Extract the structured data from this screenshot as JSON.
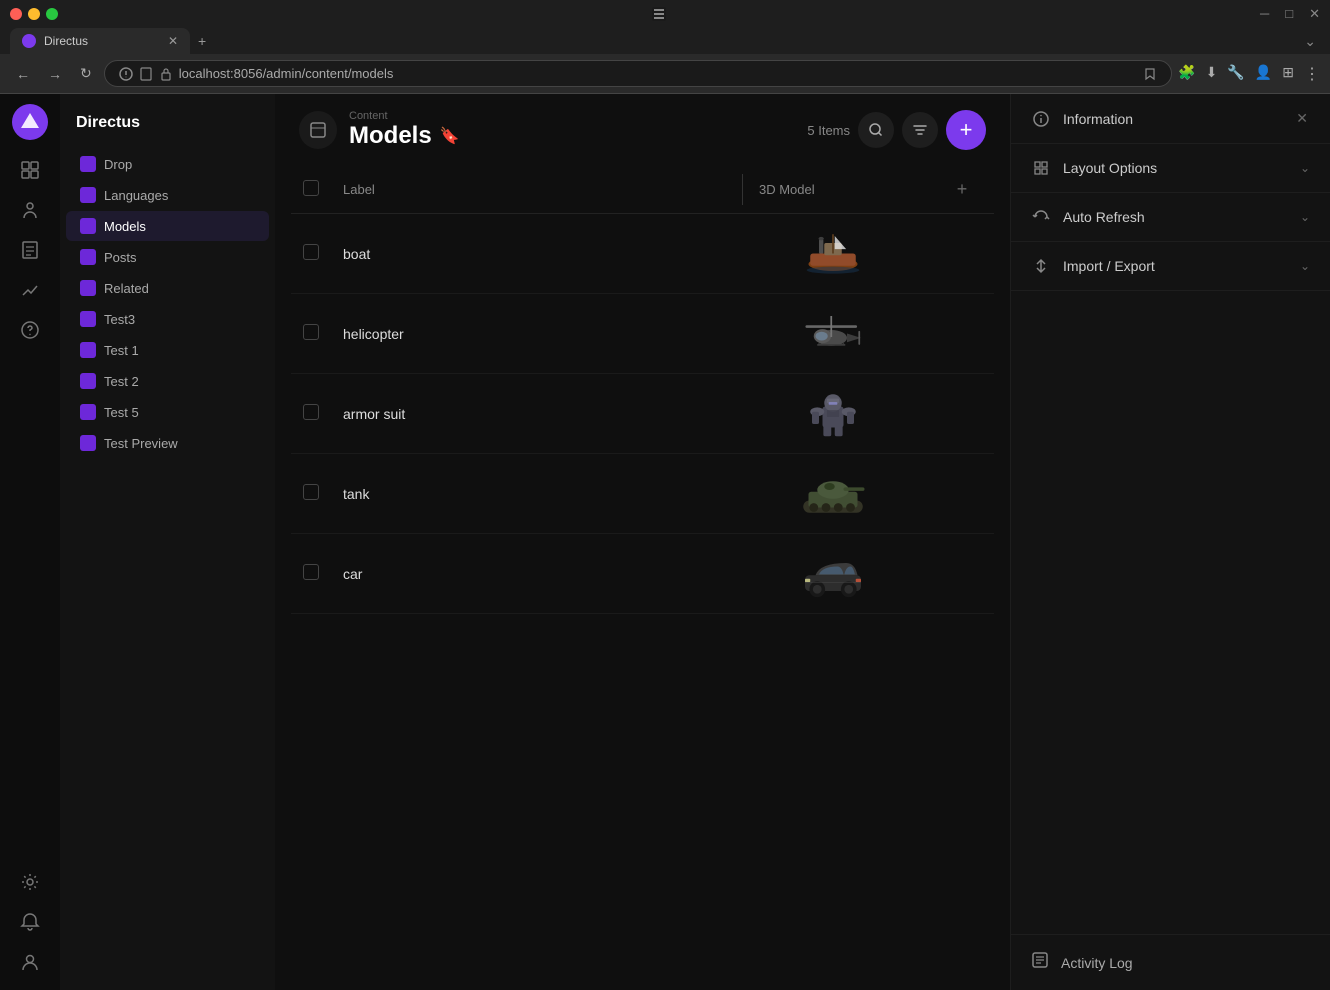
{
  "browser": {
    "tab_title": "Directus",
    "url": "localhost:8056/admin/content/models",
    "nav_back": "←",
    "nav_forward": "→",
    "nav_refresh": "↻"
  },
  "icon_sidebar": {
    "items": [
      {
        "name": "content-icon",
        "symbol": "◧"
      },
      {
        "name": "users-icon",
        "symbol": "👤"
      },
      {
        "name": "files-icon",
        "symbol": "📁"
      },
      {
        "name": "analytics-icon",
        "symbol": "📊"
      },
      {
        "name": "help-icon",
        "symbol": "?"
      },
      {
        "name": "settings-icon",
        "symbol": "⚙"
      }
    ],
    "bell_label": "🔔",
    "user_label": "👤"
  },
  "nav_sidebar": {
    "title": "Directus",
    "items": [
      {
        "label": "Drop",
        "active": false
      },
      {
        "label": "Languages",
        "active": false
      },
      {
        "label": "Models",
        "active": true
      },
      {
        "label": "Posts",
        "active": false
      },
      {
        "label": "Related",
        "active": false
      },
      {
        "label": "Test3",
        "active": false
      },
      {
        "label": "Test 1",
        "active": false
      },
      {
        "label": "Test 2",
        "active": false
      },
      {
        "label": "Test 5",
        "active": false
      },
      {
        "label": "Test Preview",
        "active": false
      }
    ]
  },
  "content": {
    "breadcrumb": "Content",
    "title": "Models",
    "items_count": "5 Items",
    "add_button": "+",
    "search_placeholder": "Search...",
    "columns": {
      "label": "Label",
      "model": "3D Model"
    },
    "rows": [
      {
        "label": "boat",
        "model_type": "boat"
      },
      {
        "label": "helicopter",
        "model_type": "helicopter"
      },
      {
        "label": "armor suit",
        "model_type": "armor"
      },
      {
        "label": "tank",
        "model_type": "tank"
      },
      {
        "label": "car",
        "model_type": "car"
      }
    ]
  },
  "right_panel": {
    "sections": [
      {
        "id": "information",
        "icon": "ℹ",
        "title": "Information",
        "has_close": true,
        "expanded": true
      },
      {
        "id": "layout-options",
        "icon": "⬡",
        "title": "Layout Options",
        "expanded": false
      },
      {
        "id": "auto-refresh",
        "icon": "⟳",
        "title": "Auto Refresh",
        "expanded": false
      },
      {
        "id": "import-export",
        "icon": "↕",
        "title": "Import / Export",
        "expanded": false
      }
    ],
    "activity_log": {
      "icon": "📋",
      "label": "Activity Log"
    }
  }
}
